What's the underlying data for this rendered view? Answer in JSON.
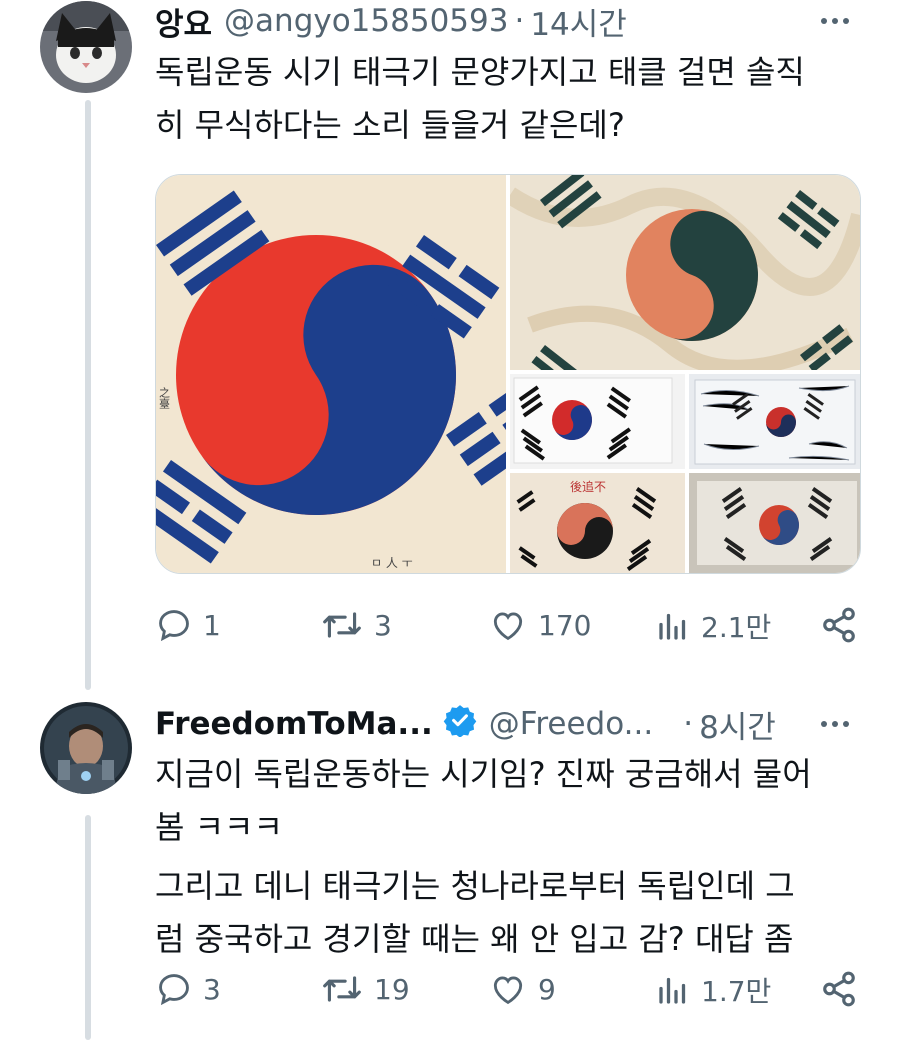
{
  "tweet1": {
    "name": "앙요",
    "handle": "@angyo15850593",
    "time": "14시간",
    "text_lines": [
      "독립운동 시기 태극기 문양가지고 태클 걸면 솔직",
      "히 무식하다는 소리 들을거 같은데?"
    ],
    "media": {
      "inscription_side": "之臺",
      "inscription_bottom": "ㅁ 人 ㅜ",
      "inscription_top": "後追不"
    },
    "stats": {
      "replies": "1",
      "retweets": "3",
      "likes": "170",
      "views": "2.1만"
    }
  },
  "tweet2": {
    "name": "FreedomToMa...",
    "handle": "@Freedo...",
    "time": "8시간",
    "text_lines": [
      "지금이 독립운동하는 시기임? 진짜 궁금해서 물어",
      "봄 ㅋㅋㅋ",
      "그리고 데니 태극기는 청나라로부터 독립인데 그",
      "럼 중국하고 경기할 때는 왜 안 입고 감? 대답 좀"
    ],
    "stats": {
      "replies": "3",
      "retweets": "19",
      "likes": "9",
      "views": "1.7만"
    }
  },
  "colors": {
    "red": "#e8392d",
    "blue": "#1d3f8c",
    "text": "#0f1419",
    "muted": "#536471",
    "verified": "#1d9bf0"
  },
  "icons": [
    "reply-icon",
    "retweet-icon",
    "like-icon",
    "views-icon",
    "share-icon",
    "more-icon",
    "verified-badge-icon"
  ]
}
